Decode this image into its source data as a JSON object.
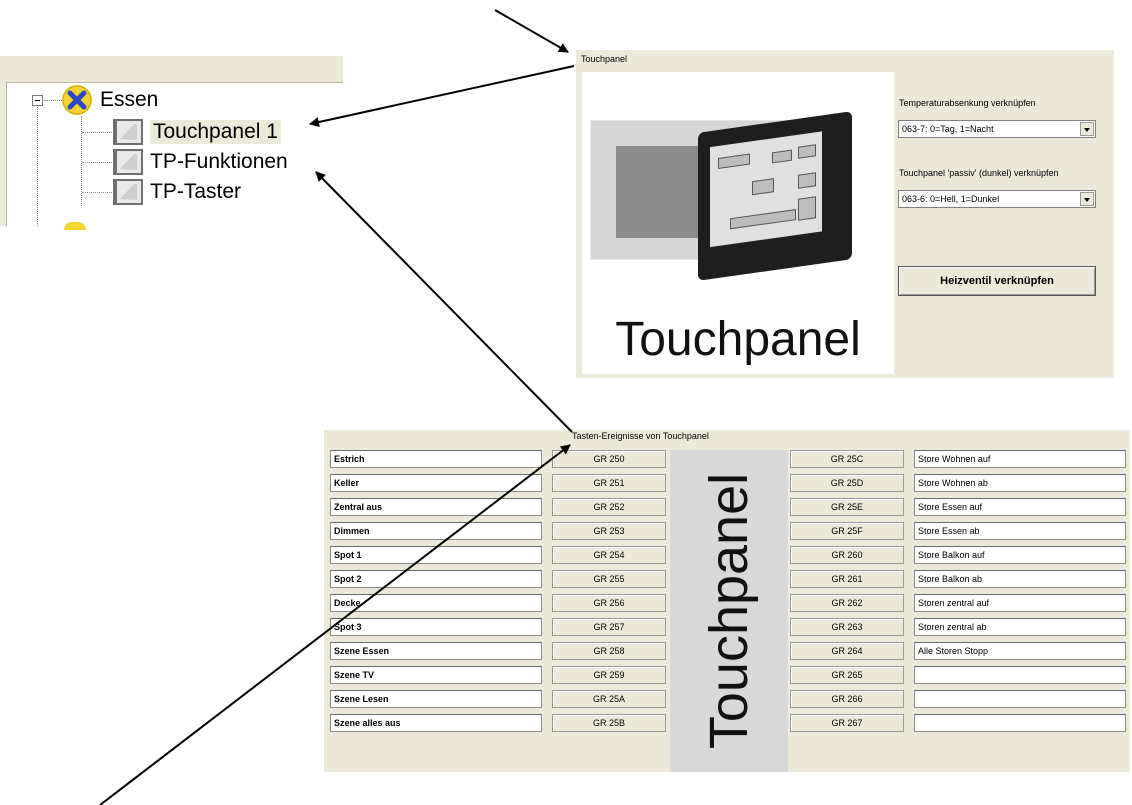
{
  "tree": {
    "root_label": "Essen",
    "items": [
      {
        "label": "Touchpanel 1",
        "selected": true
      },
      {
        "label": "TP-Funktionen",
        "selected": false
      },
      {
        "label": "TP-Taster",
        "selected": false
      }
    ]
  },
  "touchpanel": {
    "title": "Touchpanel",
    "image_caption": "Touchpanel",
    "temp_label": "Temperaturabsenkung verknüpfen",
    "temp_value": "063-7: 0=Tag, 1=Nacht",
    "passive_label": "Touchpanel 'passiv' (dunkel) verknüpfen",
    "passive_value": "063-6: 0=Hell, 1=Dunkel",
    "heat_button": "Heizventil verknüpfen"
  },
  "events": {
    "title": "Tasten-Ereignisse von Touchpanel",
    "center_label": "Touchpanel",
    "rows": [
      {
        "name": "Estrich",
        "group": "GR 250",
        "right_group": "GR 25C",
        "right_name": "Store Wohnen auf"
      },
      {
        "name": "Keller",
        "group": "GR 251",
        "right_group": "GR 25D",
        "right_name": "Store Wohnen ab"
      },
      {
        "name": "Zentral aus",
        "group": "GR 252",
        "right_group": "GR 25E",
        "right_name": "Store Essen auf"
      },
      {
        "name": "Dimmen",
        "group": "GR 253",
        "right_group": "GR 25F",
        "right_name": "Store Essen ab"
      },
      {
        "name": "Spot 1",
        "group": "GR 254",
        "right_group": "GR 260",
        "right_name": "Store Balkon auf"
      },
      {
        "name": "Spot 2",
        "group": "GR 255",
        "right_group": "GR 261",
        "right_name": "Store Balkon ab"
      },
      {
        "name": "Decke",
        "group": "GR 256",
        "right_group": "GR 262",
        "right_name": "Storen zentral auf"
      },
      {
        "name": "Spot 3",
        "group": "GR 257",
        "right_group": "GR 263",
        "right_name": "Storen zentral ab"
      },
      {
        "name": "Szene Essen",
        "group": "GR 258",
        "right_group": "GR 264",
        "right_name": "Alle Storen Stopp"
      },
      {
        "name": "Szene TV",
        "group": "GR 259",
        "right_group": "GR 265",
        "right_name": ""
      },
      {
        "name": "Szene Lesen",
        "group": "GR 25A",
        "right_group": "GR 266",
        "right_name": ""
      },
      {
        "name": "Szene alles aus",
        "group": "GR 25B",
        "right_group": "GR 267",
        "right_name": ""
      }
    ]
  }
}
